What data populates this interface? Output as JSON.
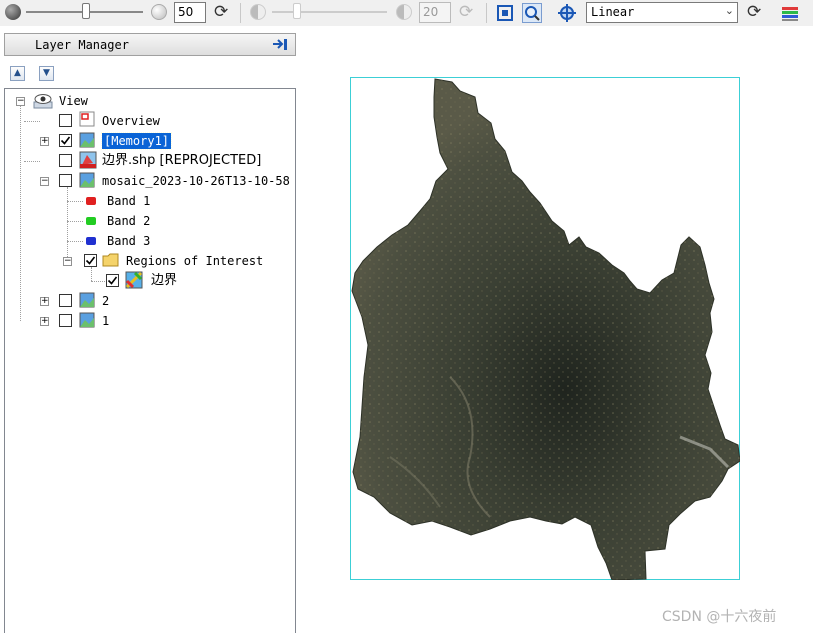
{
  "toolbar": {
    "brightness_value": "50",
    "transparency_value": "20",
    "stretch_select": "Linear",
    "icons": [
      "brightness-dark-icon",
      "brightness-light-icon",
      "refresh-icon",
      "transparency-icon",
      "zoom-extent-icon",
      "zoom-pan-icon",
      "fit-icon",
      "stretch-refresh-icon",
      "histogram-icon"
    ]
  },
  "layer_manager": {
    "title": "Layer Manager",
    "tree": {
      "root": "View",
      "items": [
        {
          "label": "Overview",
          "checked": false
        },
        {
          "label": "[Memory1]",
          "checked": true,
          "selected": true
        },
        {
          "label": "边界.shp [REPROJECTED]",
          "checked": false
        },
        {
          "label": "mosaic_2023-10-26T13-10-58",
          "checked": false
        },
        {
          "label": "Band 1",
          "color": "#e02020"
        },
        {
          "label": "Band 2",
          "color": "#22cc22"
        },
        {
          "label": "Band 3",
          "color": "#2030d0"
        },
        {
          "label": "Regions of Interest",
          "checked": true
        },
        {
          "label": "边界",
          "checked": true
        },
        {
          "label": "2",
          "checked": false
        },
        {
          "label": "1",
          "checked": false
        }
      ]
    }
  },
  "watermark": "CSDN @十六夜前",
  "colors": {
    "extent_border": "#3ccfd6",
    "selection": "#0a64d6"
  }
}
